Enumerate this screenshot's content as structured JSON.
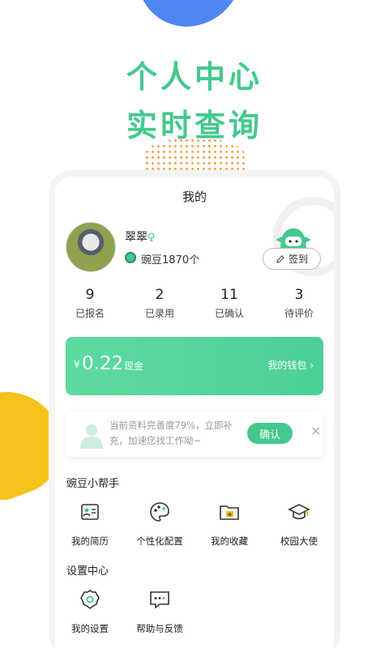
{
  "promo": {
    "line1": "个人中心",
    "line2": "实时查询"
  },
  "page": {
    "title": "我的"
  },
  "profile": {
    "name": "翠翠",
    "gender_symbol": "♀",
    "beans": "豌豆1870个",
    "signin_label": "签到"
  },
  "stats": [
    {
      "num": "9",
      "label": "已报名"
    },
    {
      "num": "2",
      "label": "已录用"
    },
    {
      "num": "11",
      "label": "已确认"
    },
    {
      "num": "3",
      "label": "待评价"
    }
  ],
  "wallet": {
    "currency": "¥",
    "amount": "0.22",
    "unit": "现金",
    "link": "我的钱包",
    "arrow": "›"
  },
  "notice": {
    "text": "当前资料完善度79%，立即补充，加速您找工作呦~",
    "confirm": "确认",
    "close": "×"
  },
  "helper": {
    "title": "豌豆小帮手",
    "items": [
      {
        "label": "我的简历",
        "icon": "resume-icon"
      },
      {
        "label": "个性化配置",
        "icon": "palette-icon"
      },
      {
        "label": "我的收藏",
        "icon": "favorites-folder-icon"
      },
      {
        "label": "校园大使",
        "icon": "graduation-cap-icon"
      }
    ]
  },
  "settings": {
    "title": "设置中心",
    "items": [
      {
        "label": "我的设置",
        "icon": "gear-icon"
      },
      {
        "label": "帮助与反馈",
        "icon": "feedback-icon"
      }
    ]
  },
  "colors": {
    "accent": "#43c98d",
    "blue_blob": "#4f86f3",
    "yellow_blob": "#f7c21b",
    "dots": "#f3a046"
  }
}
